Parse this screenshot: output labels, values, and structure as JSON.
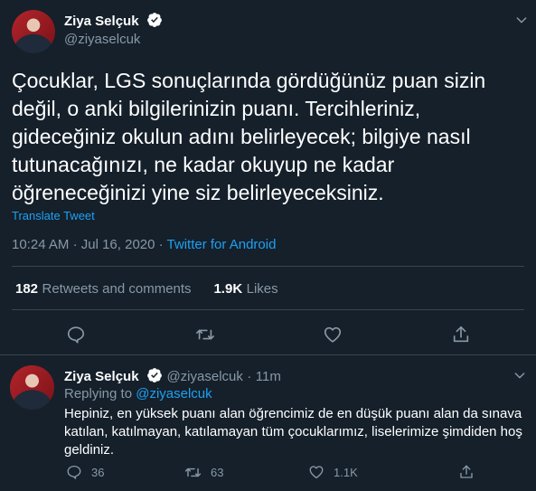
{
  "tweet": {
    "author_name": "Ziya Selçuk",
    "author_handle": "@ziyaselcuk",
    "text_lines": [
      "Çocuklar, LGS sonuçlarında gördüğünüz puan sizin",
      "değil, o anki bilgilerinizin puanı. Tercihleriniz,",
      "gideceğiniz okulun adını belirleyecek; bilgiye nasıl",
      "tutunacağınızı, ne kadar okuyup ne kadar",
      "öğreneceğinizi yine siz belirleyeceksiniz."
    ],
    "translate_label": "Translate Tweet",
    "time": "10:24 AM",
    "dot": "·",
    "date": "Jul 16, 2020",
    "source": "Twitter for Android",
    "retweets_count": "182",
    "retweets_label": "Retweets and comments",
    "likes_count": "1.9K",
    "likes_label": "Likes"
  },
  "reply": {
    "author_name": "Ziya Selçuk",
    "author_handle": "@ziyaselcuk",
    "dot": "·",
    "time_ago": "11m",
    "replying_to_label": "Replying to",
    "replying_to_handle": "@ziyaselcuk",
    "text_lines": [
      "Hepiniz, en yüksek puanı alan öğrencimiz de en düşük puanı alan da sınava",
      "katılan, katılmayan, katılamayan tüm çocuklarımız, liselerimize şimdiden hoş",
      "geldiniz."
    ],
    "reply_count": "36",
    "retweet_count": "63",
    "like_count": "1.1K"
  },
  "colors": {
    "background": "#15202b",
    "accent": "#1da1f2",
    "muted": "#8899a6",
    "divider": "#38444d"
  },
  "icons": [
    "chevron-down-icon",
    "verified-badge-icon",
    "reply-icon",
    "retweet-icon",
    "like-icon",
    "share-icon"
  ]
}
